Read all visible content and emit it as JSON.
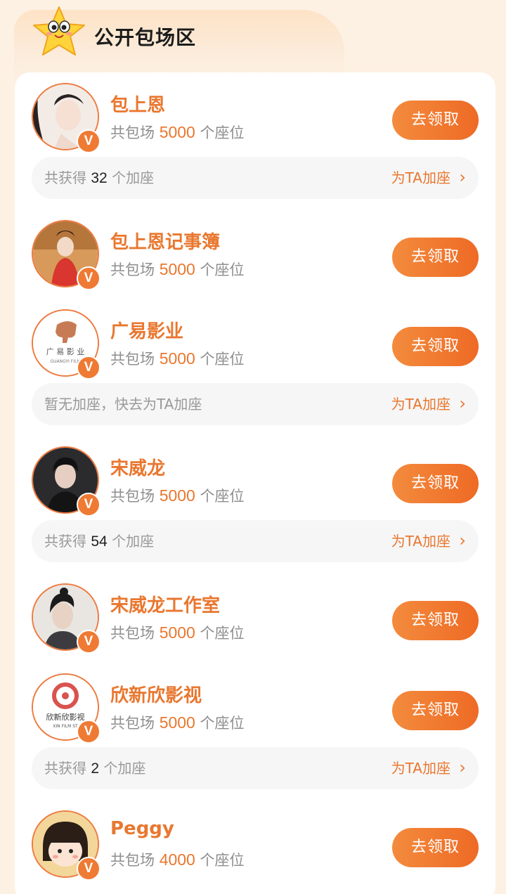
{
  "section": {
    "title": "公开包场区",
    "mascot_icon": "star-mascot-icon"
  },
  "claim_label": "去领取",
  "seat_prefix": "共包场",
  "seat_suffix": "个座位",
  "bar_labels": {
    "prefix": "共获得",
    "suffix": "个加座",
    "empty": "暂无加座，快去为TA加座",
    "link": "为TA加座",
    "arrow": "›"
  },
  "badge_label": "V",
  "entries": [
    {
      "name": "包上恩",
      "seats": "5000",
      "bonus": "32"
    },
    {
      "name": "包上恩记事簿",
      "seats": "5000",
      "bonus": null
    },
    {
      "name": "广易影业",
      "seats": "5000",
      "bonus": "",
      "avatar_text": "广 易 影 业",
      "avatar_subtext": "GUANGYI FILM"
    },
    {
      "name": "宋威龙",
      "seats": "5000",
      "bonus": "54"
    },
    {
      "name": "宋威龙工作室",
      "seats": "5000",
      "bonus": null
    },
    {
      "name": "欣新欣影视",
      "seats": "5000",
      "bonus": "2",
      "avatar_text": "欣新欣影视",
      "avatar_subtext": "XIN FILM ST"
    },
    {
      "name": "Peggy",
      "seats": "4000",
      "bonus": null
    }
  ],
  "colors": {
    "accent": "#e9772f",
    "button_start": "#f38b3d",
    "button_end": "#ee6a25",
    "page_bg": "#fdf1e4"
  }
}
